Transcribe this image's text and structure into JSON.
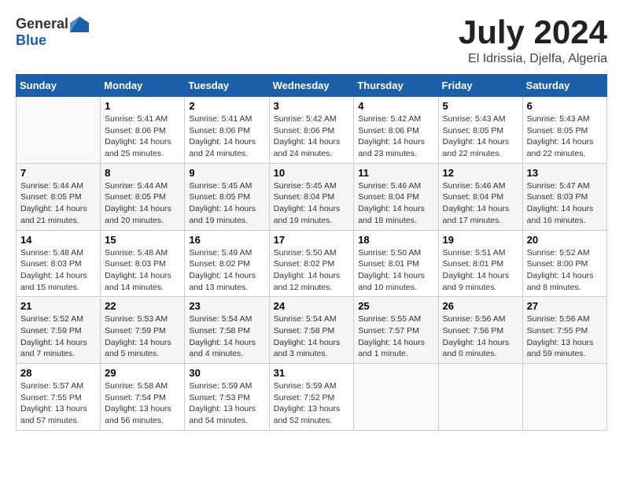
{
  "logo": {
    "general": "General",
    "blue": "Blue"
  },
  "title": {
    "month_year": "July 2024",
    "location": "El Idrissia, Djelfa, Algeria"
  },
  "headers": [
    "Sunday",
    "Monday",
    "Tuesday",
    "Wednesday",
    "Thursday",
    "Friday",
    "Saturday"
  ],
  "weeks": [
    [
      {
        "day": "",
        "info": ""
      },
      {
        "day": "1",
        "info": "Sunrise: 5:41 AM\nSunset: 8:06 PM\nDaylight: 14 hours\nand 25 minutes."
      },
      {
        "day": "2",
        "info": "Sunrise: 5:41 AM\nSunset: 8:06 PM\nDaylight: 14 hours\nand 24 minutes."
      },
      {
        "day": "3",
        "info": "Sunrise: 5:42 AM\nSunset: 8:06 PM\nDaylight: 14 hours\nand 24 minutes."
      },
      {
        "day": "4",
        "info": "Sunrise: 5:42 AM\nSunset: 8:06 PM\nDaylight: 14 hours\nand 23 minutes."
      },
      {
        "day": "5",
        "info": "Sunrise: 5:43 AM\nSunset: 8:05 PM\nDaylight: 14 hours\nand 22 minutes."
      },
      {
        "day": "6",
        "info": "Sunrise: 5:43 AM\nSunset: 8:05 PM\nDaylight: 14 hours\nand 22 minutes."
      }
    ],
    [
      {
        "day": "7",
        "info": "Sunrise: 5:44 AM\nSunset: 8:05 PM\nDaylight: 14 hours\nand 21 minutes."
      },
      {
        "day": "8",
        "info": "Sunrise: 5:44 AM\nSunset: 8:05 PM\nDaylight: 14 hours\nand 20 minutes."
      },
      {
        "day": "9",
        "info": "Sunrise: 5:45 AM\nSunset: 8:05 PM\nDaylight: 14 hours\nand 19 minutes."
      },
      {
        "day": "10",
        "info": "Sunrise: 5:45 AM\nSunset: 8:04 PM\nDaylight: 14 hours\nand 19 minutes."
      },
      {
        "day": "11",
        "info": "Sunrise: 5:46 AM\nSunset: 8:04 PM\nDaylight: 14 hours\nand 18 minutes."
      },
      {
        "day": "12",
        "info": "Sunrise: 5:46 AM\nSunset: 8:04 PM\nDaylight: 14 hours\nand 17 minutes."
      },
      {
        "day": "13",
        "info": "Sunrise: 5:47 AM\nSunset: 8:03 PM\nDaylight: 14 hours\nand 16 minutes."
      }
    ],
    [
      {
        "day": "14",
        "info": "Sunrise: 5:48 AM\nSunset: 8:03 PM\nDaylight: 14 hours\nand 15 minutes."
      },
      {
        "day": "15",
        "info": "Sunrise: 5:48 AM\nSunset: 8:03 PM\nDaylight: 14 hours\nand 14 minutes."
      },
      {
        "day": "16",
        "info": "Sunrise: 5:49 AM\nSunset: 8:02 PM\nDaylight: 14 hours\nand 13 minutes."
      },
      {
        "day": "17",
        "info": "Sunrise: 5:50 AM\nSunset: 8:02 PM\nDaylight: 14 hours\nand 12 minutes."
      },
      {
        "day": "18",
        "info": "Sunrise: 5:50 AM\nSunset: 8:01 PM\nDaylight: 14 hours\nand 10 minutes."
      },
      {
        "day": "19",
        "info": "Sunrise: 5:51 AM\nSunset: 8:01 PM\nDaylight: 14 hours\nand 9 minutes."
      },
      {
        "day": "20",
        "info": "Sunrise: 5:52 AM\nSunset: 8:00 PM\nDaylight: 14 hours\nand 8 minutes."
      }
    ],
    [
      {
        "day": "21",
        "info": "Sunrise: 5:52 AM\nSunset: 7:59 PM\nDaylight: 14 hours\nand 7 minutes."
      },
      {
        "day": "22",
        "info": "Sunrise: 5:53 AM\nSunset: 7:59 PM\nDaylight: 14 hours\nand 5 minutes."
      },
      {
        "day": "23",
        "info": "Sunrise: 5:54 AM\nSunset: 7:58 PM\nDaylight: 14 hours\nand 4 minutes."
      },
      {
        "day": "24",
        "info": "Sunrise: 5:54 AM\nSunset: 7:58 PM\nDaylight: 14 hours\nand 3 minutes."
      },
      {
        "day": "25",
        "info": "Sunrise: 5:55 AM\nSunset: 7:57 PM\nDaylight: 14 hours\nand 1 minute."
      },
      {
        "day": "26",
        "info": "Sunrise: 5:56 AM\nSunset: 7:56 PM\nDaylight: 14 hours\nand 0 minutes."
      },
      {
        "day": "27",
        "info": "Sunrise: 5:56 AM\nSunset: 7:55 PM\nDaylight: 13 hours\nand 59 minutes."
      }
    ],
    [
      {
        "day": "28",
        "info": "Sunrise: 5:57 AM\nSunset: 7:55 PM\nDaylight: 13 hours\nand 57 minutes."
      },
      {
        "day": "29",
        "info": "Sunrise: 5:58 AM\nSunset: 7:54 PM\nDaylight: 13 hours\nand 56 minutes."
      },
      {
        "day": "30",
        "info": "Sunrise: 5:59 AM\nSunset: 7:53 PM\nDaylight: 13 hours\nand 54 minutes."
      },
      {
        "day": "31",
        "info": "Sunrise: 5:59 AM\nSunset: 7:52 PM\nDaylight: 13 hours\nand 52 minutes."
      },
      {
        "day": "",
        "info": ""
      },
      {
        "day": "",
        "info": ""
      },
      {
        "day": "",
        "info": ""
      }
    ]
  ]
}
